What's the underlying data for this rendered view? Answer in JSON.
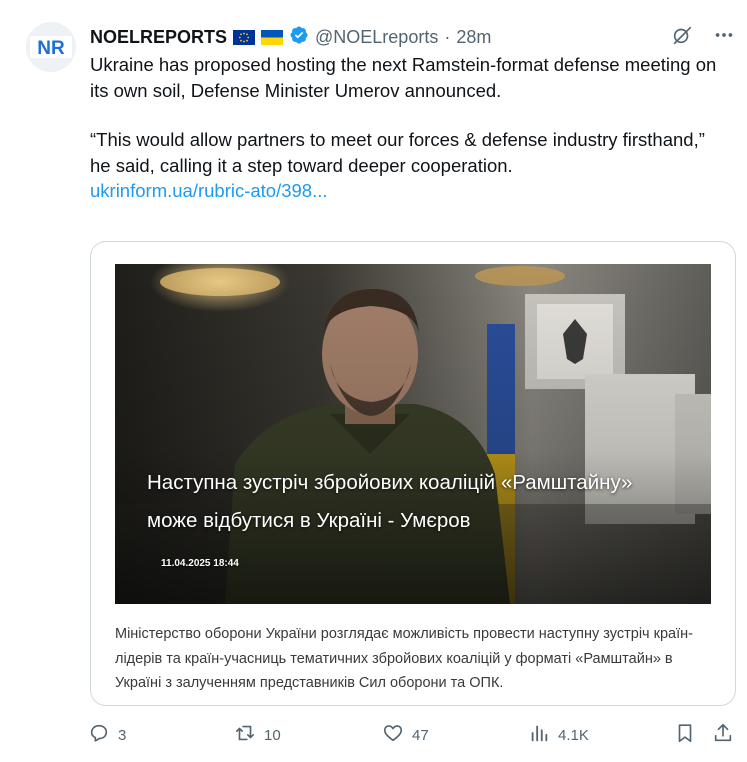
{
  "author": {
    "name": "NOELREPORTS",
    "handle": "@NOELreports",
    "separator": "·",
    "time": "28m",
    "avatar_text": "NR",
    "verified": true,
    "flags": [
      "eu-flag",
      "ukraine-flag"
    ]
  },
  "tweet": {
    "paragraph1": "Ukraine has proposed hosting the next Ramstein-format defense meeting on its own soil, Defense Minister Umerov announced.",
    "paragraph2": "“This would allow partners to meet our forces & defense industry firsthand,” he said, calling it a step toward deeper cooperation.",
    "link": "ukrinform.ua/rubric-ato/398..."
  },
  "card": {
    "headline_line1": "Наступна зустріч збройових коаліцій «Рамштайну»",
    "headline_line2": "може відбутися в Україні - Умєров",
    "date": "11.04.2025 18:44",
    "description": "Міністерство оборони України розглядає можливість провести наступну зустріч країн-лідерів та країн-учасниць тематичних збройових коаліцій у форматі «Рамштайн» в Україні з залученням представників Сил оборони та ОПК."
  },
  "actions": {
    "replies": "3",
    "reposts": "10",
    "likes": "47",
    "views": "4.1K"
  },
  "colors": {
    "accent": "#1d9bf0",
    "text": "#0f1419",
    "muted": "#536471",
    "border": "#cfd9de",
    "eu_blue": "#003399",
    "eu_star": "#ffcc00",
    "ua_blue": "#0057b7",
    "ua_yellow": "#ffd700"
  }
}
